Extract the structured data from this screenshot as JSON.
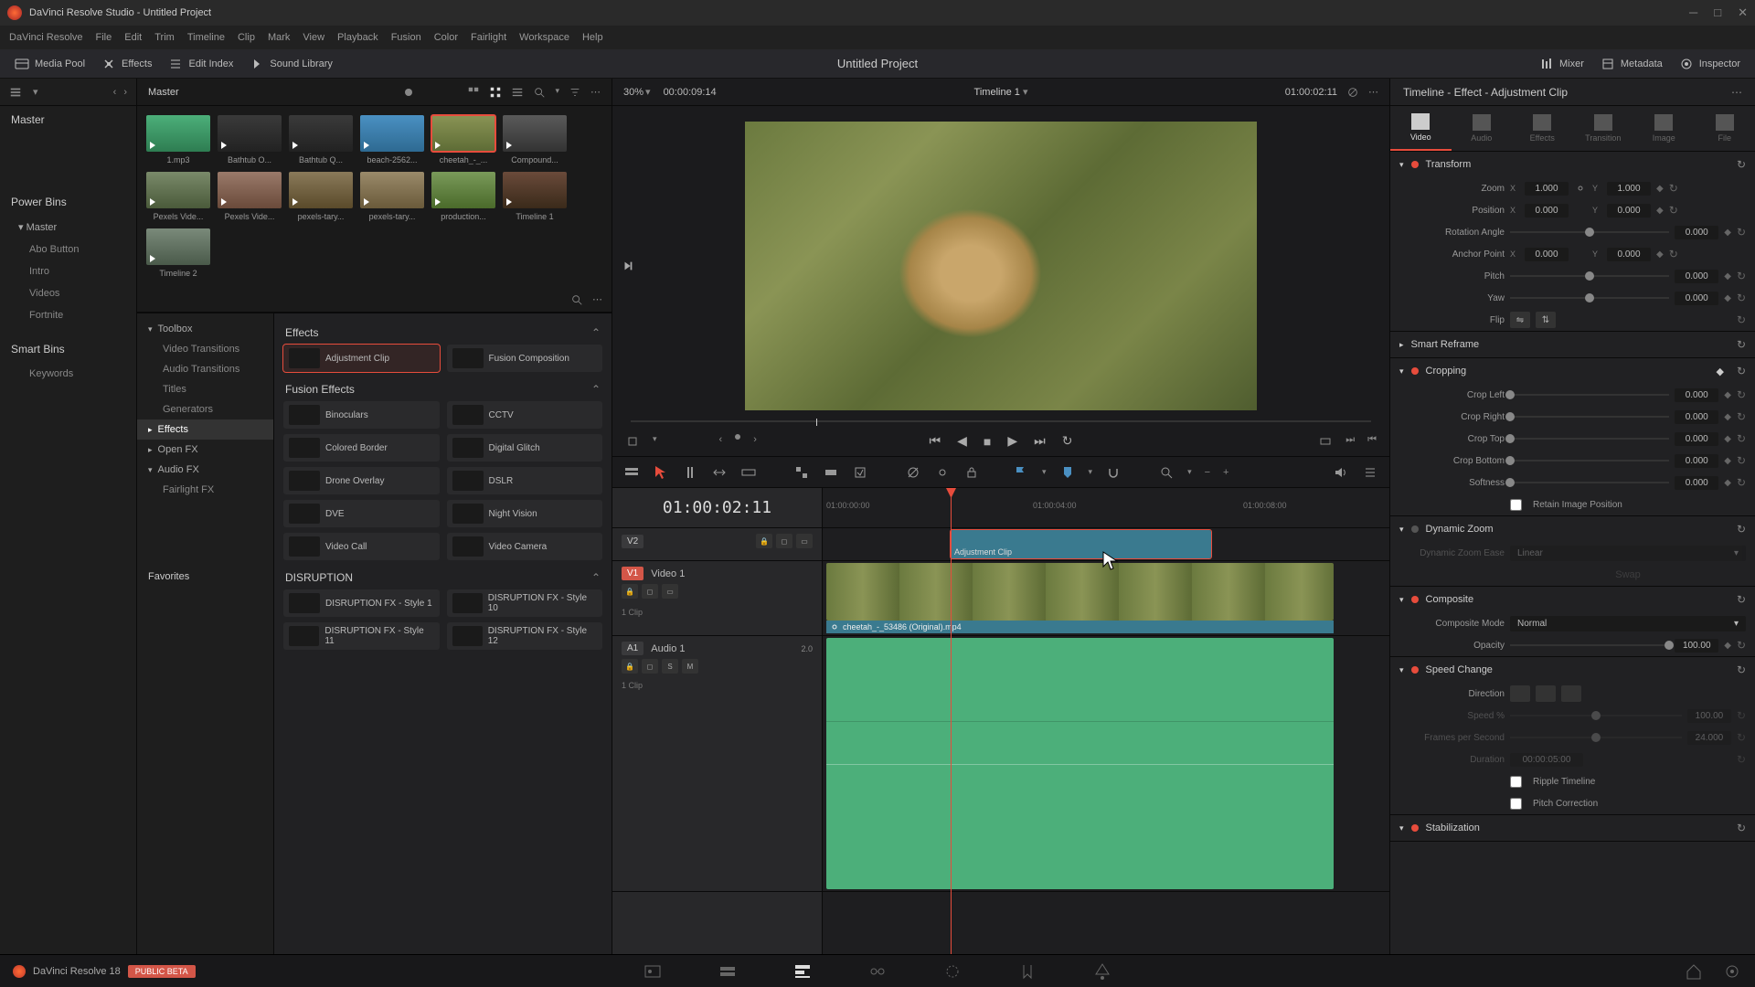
{
  "titlebar": {
    "title": "DaVinci Resolve Studio - Untitled Project"
  },
  "menubar": [
    "DaVinci Resolve",
    "File",
    "Edit",
    "Trim",
    "Timeline",
    "Clip",
    "Mark",
    "View",
    "Playback",
    "Fusion",
    "Color",
    "Fairlight",
    "Workspace",
    "Help"
  ],
  "toolbar": {
    "mediapool": "Media Pool",
    "effects": "Effects",
    "editindex": "Edit Index",
    "soundlib": "Sound Library",
    "project": "Untitled Project",
    "mixer": "Mixer",
    "metadata": "Metadata",
    "inspector": "Inspector"
  },
  "leftcol": {
    "master": "Master",
    "powerbins": "Power Bins",
    "master2": "Master",
    "subs": [
      "Abo Button",
      "Intro",
      "Videos",
      "Fortnite"
    ],
    "smartbins": "Smart Bins",
    "keywords": "Keywords",
    "favorites": "Favorites"
  },
  "mediapool": {
    "title": "Master",
    "clips": [
      {
        "name": "1.mp3",
        "bg": "linear-gradient(#4caf7a,#2e7d52)"
      },
      {
        "name": "Bathtub O...",
        "bg": "linear-gradient(#3a3a3a,#222)"
      },
      {
        "name": "Bathtub Q...",
        "bg": "linear-gradient(#3a3a3a,#222)"
      },
      {
        "name": "beach-2562...",
        "bg": "linear-gradient(#4a90c2,#2e6a92)"
      },
      {
        "name": "cheetah_-_...",
        "bg": "linear-gradient(#8a9455,#5d6b35)",
        "selected": true
      },
      {
        "name": "Compound...",
        "bg": "linear-gradient(#5a5a5a,#333)"
      },
      {
        "name": "Pexels Vide...",
        "bg": "linear-gradient(#7a8a6a,#4a5a3a)"
      },
      {
        "name": "Pexels Vide...",
        "bg": "linear-gradient(#9a7a6a,#6a4a3a)"
      },
      {
        "name": "pexels-tary...",
        "bg": "linear-gradient(#8a7a5a,#5a4a2a)"
      },
      {
        "name": "pexels-tary...",
        "bg": "linear-gradient(#9a8a6a,#6a5a3a)"
      },
      {
        "name": "production...",
        "bg": "linear-gradient(#7a9a5a,#4a6a2a)"
      },
      {
        "name": "Timeline 1",
        "bg": "linear-gradient(#6a4a3a,#3a2a1a)"
      },
      {
        "name": "Timeline 2",
        "bg": "linear-gradient(#7a8a7a,#4a5a4a)"
      }
    ]
  },
  "fxtree": {
    "toolbox": "Toolbox",
    "items": [
      "Video Transitions",
      "Audio Transitions",
      "Titles",
      "Generators"
    ],
    "effects": "Effects",
    "openfx": "Open FX",
    "audiofx": "Audio FX",
    "fairlight": "Fairlight FX"
  },
  "fxlist": {
    "section1": "Effects",
    "adjclip": "Adjustment Clip",
    "fusioncomp": "Fusion Composition",
    "section2": "Fusion Effects",
    "fx": [
      [
        "Binoculars",
        "CCTV"
      ],
      [
        "Colored Border",
        "Digital Glitch"
      ],
      [
        "Drone Overlay",
        "DSLR"
      ],
      [
        "DVE",
        "Night Vision"
      ],
      [
        "Video Call",
        "Video Camera"
      ]
    ],
    "section3": "DISRUPTION",
    "dfx": [
      [
        "DISRUPTION FX - Style 1",
        "DISRUPTION FX - Style 10"
      ],
      [
        "DISRUPTION FX - Style 11",
        "DISRUPTION FX - Style 12"
      ]
    ]
  },
  "viewer": {
    "zoom": "30%",
    "tc_left": "00:00:09:14",
    "timeline_name": "Timeline 1",
    "tc_right": "01:00:02:11"
  },
  "timeline": {
    "tc": "01:00:02:11",
    "ruler": [
      "01:00:00:00",
      "01:00:04:00",
      "01:00:08:00"
    ],
    "tracks": {
      "v2": "V2",
      "v1": "V1",
      "v1_name": "Video 1",
      "v1_sub": "1 Clip",
      "a1": "A1",
      "a1_name": "Audio 1",
      "a1_level": "2.0",
      "a1_sub": "1 Clip"
    },
    "adjclip": "Adjustment Clip",
    "vidclip": "cheetah_-_53486 (Original).mp4"
  },
  "inspector": {
    "title": "Timeline - Effect - Adjustment Clip",
    "tabs": [
      "Video",
      "Audio",
      "Effects",
      "Transition",
      "Image",
      "File"
    ],
    "transform": {
      "hdr": "Transform",
      "zoom": "Zoom",
      "zoom_x": "1.000",
      "zoom_y": "1.000",
      "position": "Position",
      "pos_x": "0.000",
      "pos_y": "0.000",
      "rotation": "Rotation Angle",
      "rot_v": "0.000",
      "anchor": "Anchor Point",
      "anc_x": "0.000",
      "anc_y": "0.000",
      "pitch": "Pitch",
      "pitch_v": "0.000",
      "yaw": "Yaw",
      "yaw_v": "0.000",
      "flip": "Flip"
    },
    "smartreframe": "Smart Reframe",
    "cropping": {
      "hdr": "Cropping",
      "left": "Crop Left",
      "left_v": "0.000",
      "right": "Crop Right",
      "right_v": "0.000",
      "top": "Crop Top",
      "top_v": "0.000",
      "bottom": "Crop Bottom",
      "bottom_v": "0.000",
      "softness": "Softness",
      "soft_v": "0.000",
      "retain": "Retain Image Position"
    },
    "dynzoom": {
      "hdr": "Dynamic Zoom",
      "ease": "Dynamic Zoom Ease",
      "linear": "Linear",
      "swap": "Swap"
    },
    "composite": {
      "hdr": "Composite",
      "mode": "Composite Mode",
      "normal": "Normal",
      "opacity": "Opacity",
      "opacity_v": "100.00"
    },
    "speed": {
      "hdr": "Speed Change",
      "direction": "Direction",
      "speedpct": "Speed %",
      "speedpct_v": "100.00",
      "fps": "Frames per Second",
      "fps_v": "24.000",
      "duration": "Duration",
      "dur_v": "00:00:05:00",
      "ripple": "Ripple Timeline",
      "pitchcorr": "Pitch Correction"
    },
    "stabilization": "Stabilization"
  },
  "pagebar": {
    "version": "DaVinci Resolve 18",
    "badge": "PUBLIC BETA"
  }
}
